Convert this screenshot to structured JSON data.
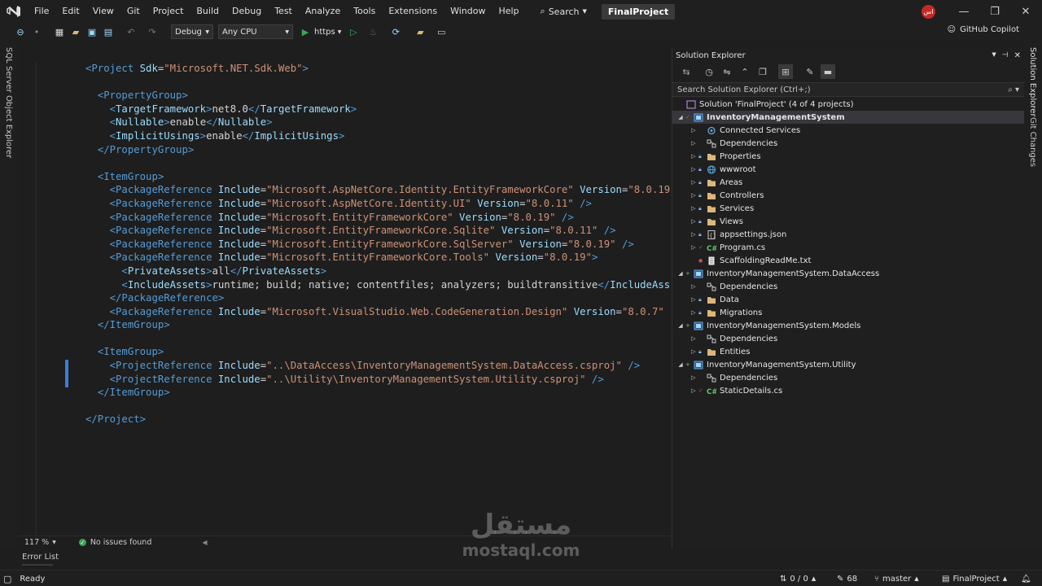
{
  "menubar": {
    "items": [
      "File",
      "Edit",
      "View",
      "Git",
      "Project",
      "Build",
      "Debug",
      "Test",
      "Analyze",
      "Tools",
      "Extensions",
      "Window",
      "Help"
    ],
    "search_label": "Search",
    "project_name": "FinalProject",
    "account_initials": "اس"
  },
  "toolbar": {
    "config": "Debug",
    "platform": "Any CPU",
    "run_target": "https",
    "copilot_label": "GitHub Copilot"
  },
  "side_tabs": {
    "left": "SQL Server Object Explorer",
    "right_1": "Solution Explorer",
    "right_2": "Git Changes"
  },
  "editor": {
    "zoom": "117 %",
    "issues": "No issues found",
    "lines": [
      [
        [
          "tag",
          "<Project "
        ],
        [
          "attr",
          "Sdk"
        ],
        [
          "txt",
          "="
        ],
        [
          "str",
          "\"Microsoft.NET.Sdk.Web\""
        ],
        [
          "tag",
          ">"
        ]
      ],
      [],
      [
        [
          "txt",
          "  "
        ],
        [
          "tag",
          "<PropertyGroup>"
        ]
      ],
      [
        [
          "txt",
          "    "
        ],
        [
          "tag",
          "<"
        ],
        [
          "attr",
          "TargetFramework"
        ],
        [
          "tag",
          ">"
        ],
        [
          "txt",
          "net8.0"
        ],
        [
          "tag",
          "</"
        ],
        [
          "attr",
          "TargetFramework"
        ],
        [
          "tag",
          ">"
        ]
      ],
      [
        [
          "txt",
          "    "
        ],
        [
          "tag",
          "<"
        ],
        [
          "attr",
          "Nullable"
        ],
        [
          "tag",
          ">"
        ],
        [
          "txt",
          "enable"
        ],
        [
          "tag",
          "</"
        ],
        [
          "attr",
          "Nullable"
        ],
        [
          "tag",
          ">"
        ]
      ],
      [
        [
          "txt",
          "    "
        ],
        [
          "tag",
          "<"
        ],
        [
          "attr",
          "ImplicitUsings"
        ],
        [
          "tag",
          ">"
        ],
        [
          "txt",
          "enable"
        ],
        [
          "tag",
          "</"
        ],
        [
          "attr",
          "ImplicitUsings"
        ],
        [
          "tag",
          ">"
        ]
      ],
      [
        [
          "txt",
          "  "
        ],
        [
          "tag",
          "</PropertyGroup>"
        ]
      ],
      [],
      [
        [
          "txt",
          "  "
        ],
        [
          "tag",
          "<ItemGroup>"
        ]
      ],
      [
        [
          "txt",
          "    "
        ],
        [
          "tag",
          "<PackageReference "
        ],
        [
          "attr",
          "Include"
        ],
        [
          "txt",
          "="
        ],
        [
          "str",
          "\"Microsoft.AspNetCore.Identity.EntityFrameworkCore\""
        ],
        [
          "txt",
          " "
        ],
        [
          "attr",
          "Version"
        ],
        [
          "txt",
          "="
        ],
        [
          "str",
          "\"8.0.19\""
        ]
      ],
      [
        [
          "txt",
          "    "
        ],
        [
          "tag",
          "<PackageReference "
        ],
        [
          "attr",
          "Include"
        ],
        [
          "txt",
          "="
        ],
        [
          "str",
          "\"Microsoft.AspNetCore.Identity.UI\""
        ],
        [
          "txt",
          " "
        ],
        [
          "attr",
          "Version"
        ],
        [
          "txt",
          "="
        ],
        [
          "str",
          "\"8.0.11\""
        ],
        [
          "tag",
          " />"
        ]
      ],
      [
        [
          "txt",
          "    "
        ],
        [
          "tag",
          "<PackageReference "
        ],
        [
          "attr",
          "Include"
        ],
        [
          "txt",
          "="
        ],
        [
          "str",
          "\"Microsoft.EntityFrameworkCore\""
        ],
        [
          "txt",
          " "
        ],
        [
          "attr",
          "Version"
        ],
        [
          "txt",
          "="
        ],
        [
          "str",
          "\"8.0.19\""
        ],
        [
          "tag",
          " />"
        ]
      ],
      [
        [
          "txt",
          "    "
        ],
        [
          "tag",
          "<PackageReference "
        ],
        [
          "attr",
          "Include"
        ],
        [
          "txt",
          "="
        ],
        [
          "str",
          "\"Microsoft.EntityFrameworkCore.Sqlite\""
        ],
        [
          "txt",
          " "
        ],
        [
          "attr",
          "Version"
        ],
        [
          "txt",
          "="
        ],
        [
          "str",
          "\"8.0.11\""
        ],
        [
          "tag",
          " />"
        ]
      ],
      [
        [
          "txt",
          "    "
        ],
        [
          "tag",
          "<PackageReference "
        ],
        [
          "attr",
          "Include"
        ],
        [
          "txt",
          "="
        ],
        [
          "str",
          "\"Microsoft.EntityFrameworkCore.SqlServer\""
        ],
        [
          "txt",
          " "
        ],
        [
          "attr",
          "Version"
        ],
        [
          "txt",
          "="
        ],
        [
          "str",
          "\"8.0.19\""
        ],
        [
          "tag",
          " />"
        ]
      ],
      [
        [
          "txt",
          "    "
        ],
        [
          "tag",
          "<PackageReference "
        ],
        [
          "attr",
          "Include"
        ],
        [
          "txt",
          "="
        ],
        [
          "str",
          "\"Microsoft.EntityFrameworkCore.Tools\""
        ],
        [
          "txt",
          " "
        ],
        [
          "attr",
          "Version"
        ],
        [
          "txt",
          "="
        ],
        [
          "str",
          "\"8.0.19\""
        ],
        [
          "tag",
          ">"
        ]
      ],
      [
        [
          "txt",
          "      "
        ],
        [
          "tag",
          "<"
        ],
        [
          "attr",
          "PrivateAssets"
        ],
        [
          "tag",
          ">"
        ],
        [
          "txt",
          "all"
        ],
        [
          "tag",
          "</"
        ],
        [
          "attr",
          "PrivateAssets"
        ],
        [
          "tag",
          ">"
        ]
      ],
      [
        [
          "txt",
          "      "
        ],
        [
          "tag",
          "<"
        ],
        [
          "attr",
          "IncludeAssets"
        ],
        [
          "tag",
          ">"
        ],
        [
          "txt",
          "runtime; build; native; contentfiles; analyzers; buildtransitive"
        ],
        [
          "tag",
          "</"
        ],
        [
          "attr",
          "IncludeAss"
        ]
      ],
      [
        [
          "txt",
          "    "
        ],
        [
          "tag",
          "</PackageReference>"
        ]
      ],
      [
        [
          "txt",
          "    "
        ],
        [
          "tag",
          "<PackageReference "
        ],
        [
          "attr",
          "Include"
        ],
        [
          "txt",
          "="
        ],
        [
          "str",
          "\"Microsoft.VisualStudio.Web.CodeGeneration.Design\""
        ],
        [
          "txt",
          " "
        ],
        [
          "attr",
          "Version"
        ],
        [
          "txt",
          "="
        ],
        [
          "str",
          "\"8.0.7\""
        ]
      ],
      [
        [
          "txt",
          "  "
        ],
        [
          "tag",
          "</ItemGroup>"
        ]
      ],
      [],
      [
        [
          "txt",
          "  "
        ],
        [
          "tag",
          "<ItemGroup>"
        ]
      ],
      [
        [
          "txt",
          "    "
        ],
        [
          "tag",
          "<ProjectReference "
        ],
        [
          "attr",
          "Include"
        ],
        [
          "txt",
          "="
        ],
        [
          "str",
          "\"..\\DataAccess\\InventoryManagementSystem.DataAccess.csproj\""
        ],
        [
          "tag",
          " />"
        ]
      ],
      [
        [
          "txt",
          "    "
        ],
        [
          "tag",
          "<ProjectReference "
        ],
        [
          "attr",
          "Include"
        ],
        [
          "txt",
          "="
        ],
        [
          "str",
          "\"..\\Utility\\InventoryManagementSystem.Utility.csproj\""
        ],
        [
          "tag",
          " />"
        ]
      ],
      [
        [
          "txt",
          "  "
        ],
        [
          "tag",
          "</ItemGroup>"
        ]
      ],
      [],
      [
        [
          "tag",
          "</Project>"
        ]
      ]
    ]
  },
  "solution_explorer": {
    "title": "Solution Explorer",
    "search_placeholder": "Search Solution Explorer (Ctrl+;)",
    "solution_label": "Solution 'FinalProject' (4 of 4 projects)",
    "tree": [
      {
        "level": 0,
        "label": "InventoryManagementSystem",
        "icon": "project",
        "expanded": true,
        "bold": true,
        "selected": true
      },
      {
        "level": 1,
        "label": "Connected Services",
        "icon": "connected"
      },
      {
        "level": 1,
        "label": "Dependencies",
        "icon": "deps"
      },
      {
        "level": 1,
        "label": "Properties",
        "icon": "folder",
        "lock": true
      },
      {
        "level": 1,
        "label": "wwwroot",
        "icon": "globe",
        "lock": true
      },
      {
        "level": 1,
        "label": "Areas",
        "icon": "folder",
        "lock": true
      },
      {
        "level": 1,
        "label": "Controllers",
        "icon": "folder",
        "lock": true
      },
      {
        "level": 1,
        "label": "Services",
        "icon": "folder",
        "lock": true
      },
      {
        "level": 1,
        "label": "Views",
        "icon": "folder",
        "lock": true
      },
      {
        "level": 1,
        "label": "appsettings.json",
        "icon": "json",
        "lock": true
      },
      {
        "level": 1,
        "label": "Program.cs",
        "icon": "cs",
        "check": true
      },
      {
        "level": 1,
        "label": "ScaffoldingReadMe.txt",
        "icon": "txt",
        "leaf": true,
        "dot": true
      },
      {
        "level": 0,
        "label": "InventoryManagementSystem.DataAccess",
        "icon": "project",
        "expanded": true,
        "plus": true
      },
      {
        "level": 1,
        "label": "Dependencies",
        "icon": "deps"
      },
      {
        "level": 1,
        "label": "Data",
        "icon": "folder",
        "lock": true
      },
      {
        "level": 1,
        "label": "Migrations",
        "icon": "folder",
        "lock": true
      },
      {
        "level": 0,
        "label": "InventoryManagementSystem.Models",
        "icon": "project",
        "expanded": true,
        "plus": true
      },
      {
        "level": 1,
        "label": "Dependencies",
        "icon": "deps"
      },
      {
        "level": 1,
        "label": "Entities",
        "icon": "folder",
        "lock": true
      },
      {
        "level": 0,
        "label": "InventoryManagementSystem.Utility",
        "icon": "project",
        "expanded": true,
        "plus": true
      },
      {
        "level": 1,
        "label": "Dependencies",
        "icon": "deps"
      },
      {
        "level": 1,
        "label": "StaticDetails.cs",
        "icon": "cs",
        "check": true
      }
    ]
  },
  "bottom": {
    "error_list": "Error List",
    "status_ready": "Ready",
    "line_col": "0 / 0",
    "pending": "68",
    "branch": "master",
    "repo": "FinalProject"
  },
  "watermark": {
    "arabic": "مستقل",
    "latin": "mostaql.com"
  },
  "colors": {
    "accent": "#3d7dd8",
    "ok": "#3ca655",
    "badge": "#c62828"
  }
}
